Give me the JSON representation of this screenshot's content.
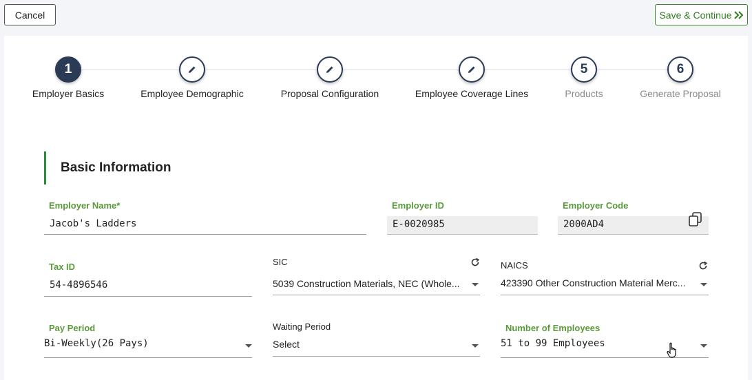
{
  "toolbar": {
    "cancel_label": "Cancel",
    "save_label": "Save & Continue"
  },
  "stepper": {
    "steps": [
      {
        "number": "1",
        "label": "Employer Basics",
        "state": "active"
      },
      {
        "number": "",
        "label": "Employee Demographic",
        "state": "edit"
      },
      {
        "number": "",
        "label": "Proposal Configuration",
        "state": "edit"
      },
      {
        "number": "",
        "label": "Employee Coverage Lines",
        "state": "edit"
      },
      {
        "number": "5",
        "label": "Products",
        "state": "pending"
      },
      {
        "number": "6",
        "label": "Generate Proposal",
        "state": "pending"
      }
    ]
  },
  "section": {
    "title": "Basic Information"
  },
  "form": {
    "employer_name": {
      "label": "Employer Name*",
      "value": "Jacob's Ladders"
    },
    "employer_id": {
      "label": "Employer ID",
      "value": "E-0020985"
    },
    "employer_code": {
      "label": "Employer Code",
      "value": "2000AD4"
    },
    "tax_id": {
      "label": "Tax ID",
      "value": "54-4896546"
    },
    "sic": {
      "label": "SIC",
      "value": "5039 Construction Materials, NEC (Whole..."
    },
    "naics": {
      "label": "NAICS",
      "value": "423390 Other Construction Material Merc..."
    },
    "pay_period": {
      "label": "Pay Period",
      "value": "Bi-Weekly(26 Pays)"
    },
    "waiting_period": {
      "label": "Waiting Period",
      "value": "Select"
    },
    "num_employees": {
      "label": "Number of Employees",
      "value": "51 to 99 Employees"
    }
  },
  "icons": {
    "edit": "pencil-icon",
    "refresh": "refresh-icon",
    "copy": "copy-icon",
    "cursor": "hand-cursor-icon",
    "save_chevron": "double-chevron-right-icon"
  },
  "colors": {
    "primary": "#2b3b55",
    "accent_green": "#2e8b3a",
    "label_green": "#5a9a3a"
  }
}
